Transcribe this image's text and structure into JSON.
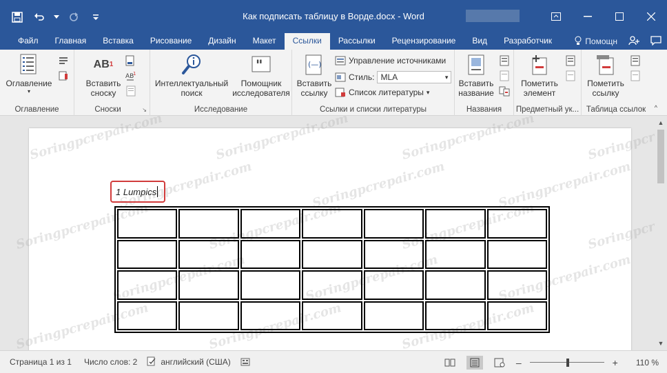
{
  "window": {
    "title": "Как подписать таблицу в Ворде.docx  -  Word",
    "colors": {
      "brand": "#2b579a",
      "ribbon": "#f3f3f3",
      "highlight_border": "#d13b3b"
    }
  },
  "tabs": [
    {
      "label": "Файл"
    },
    {
      "label": "Главная"
    },
    {
      "label": "Вставка"
    },
    {
      "label": "Рисование"
    },
    {
      "label": "Дизайн"
    },
    {
      "label": "Макет"
    },
    {
      "label": "Ссылки",
      "active": true
    },
    {
      "label": "Рассылки"
    },
    {
      "label": "Рецензирование"
    },
    {
      "label": "Вид"
    },
    {
      "label": "Разработчик"
    }
  ],
  "tell_me": "Помощн",
  "ribbon": {
    "toc": {
      "button": "Оглавление",
      "group": "Оглавление"
    },
    "footnotes": {
      "insert_line1": "Вставить",
      "insert_line2": "сноску",
      "group": "Сноски",
      "ab_label": "AB"
    },
    "research": {
      "smart_line1": "Интеллектуальный",
      "smart_line2": "поиск",
      "helper_line1": "Помощник",
      "helper_line2": "исследователя",
      "group": "Исследование"
    },
    "citations": {
      "insert_line1": "Вставить",
      "insert_line2": "ссылку",
      "manage": "Управление источниками",
      "style_label": "Стиль:",
      "style_value": "MLA",
      "bibliography": "Список литературы",
      "group": "Ссылки и списки литературы"
    },
    "captions": {
      "insert_line1": "Вставить",
      "insert_line2": "название",
      "group": "Названия"
    },
    "index": {
      "mark_line1": "Пометить",
      "mark_line2": "элемент",
      "group": "Предметный ук..."
    },
    "toa": {
      "mark_line1": "Пометить",
      "mark_line2": "ссылку",
      "group": "Таблица ссылок"
    }
  },
  "document": {
    "caption_text": "1 Lumpics",
    "table": {
      "rows": 4,
      "cols": 7
    },
    "watermark": "Soringpcrepair.com"
  },
  "status": {
    "page": "Страница 1 из 1",
    "words": "Число слов: 2",
    "language": "английский (США)",
    "zoom": "110 %",
    "zoom_percent": 110
  }
}
